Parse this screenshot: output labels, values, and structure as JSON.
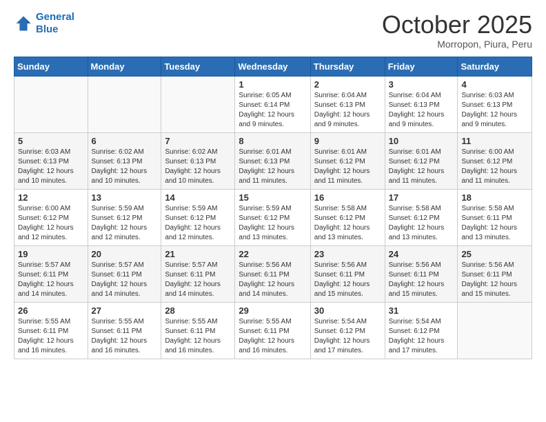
{
  "logo": {
    "line1": "General",
    "line2": "Blue"
  },
  "header": {
    "month": "October 2025",
    "location": "Morropon, Piura, Peru"
  },
  "weekdays": [
    "Sunday",
    "Monday",
    "Tuesday",
    "Wednesday",
    "Thursday",
    "Friday",
    "Saturday"
  ],
  "weeks": [
    [
      {
        "day": "",
        "info": ""
      },
      {
        "day": "",
        "info": ""
      },
      {
        "day": "",
        "info": ""
      },
      {
        "day": "1",
        "info": "Sunrise: 6:05 AM\nSunset: 6:14 PM\nDaylight: 12 hours and 9 minutes."
      },
      {
        "day": "2",
        "info": "Sunrise: 6:04 AM\nSunset: 6:13 PM\nDaylight: 12 hours and 9 minutes."
      },
      {
        "day": "3",
        "info": "Sunrise: 6:04 AM\nSunset: 6:13 PM\nDaylight: 12 hours and 9 minutes."
      },
      {
        "day": "4",
        "info": "Sunrise: 6:03 AM\nSunset: 6:13 PM\nDaylight: 12 hours and 9 minutes."
      }
    ],
    [
      {
        "day": "5",
        "info": "Sunrise: 6:03 AM\nSunset: 6:13 PM\nDaylight: 12 hours and 10 minutes."
      },
      {
        "day": "6",
        "info": "Sunrise: 6:02 AM\nSunset: 6:13 PM\nDaylight: 12 hours and 10 minutes."
      },
      {
        "day": "7",
        "info": "Sunrise: 6:02 AM\nSunset: 6:13 PM\nDaylight: 12 hours and 10 minutes."
      },
      {
        "day": "8",
        "info": "Sunrise: 6:01 AM\nSunset: 6:13 PM\nDaylight: 12 hours and 11 minutes."
      },
      {
        "day": "9",
        "info": "Sunrise: 6:01 AM\nSunset: 6:12 PM\nDaylight: 12 hours and 11 minutes."
      },
      {
        "day": "10",
        "info": "Sunrise: 6:01 AM\nSunset: 6:12 PM\nDaylight: 12 hours and 11 minutes."
      },
      {
        "day": "11",
        "info": "Sunrise: 6:00 AM\nSunset: 6:12 PM\nDaylight: 12 hours and 11 minutes."
      }
    ],
    [
      {
        "day": "12",
        "info": "Sunrise: 6:00 AM\nSunset: 6:12 PM\nDaylight: 12 hours and 12 minutes."
      },
      {
        "day": "13",
        "info": "Sunrise: 5:59 AM\nSunset: 6:12 PM\nDaylight: 12 hours and 12 minutes."
      },
      {
        "day": "14",
        "info": "Sunrise: 5:59 AM\nSunset: 6:12 PM\nDaylight: 12 hours and 12 minutes."
      },
      {
        "day": "15",
        "info": "Sunrise: 5:59 AM\nSunset: 6:12 PM\nDaylight: 12 hours and 13 minutes."
      },
      {
        "day": "16",
        "info": "Sunrise: 5:58 AM\nSunset: 6:12 PM\nDaylight: 12 hours and 13 minutes."
      },
      {
        "day": "17",
        "info": "Sunrise: 5:58 AM\nSunset: 6:12 PM\nDaylight: 12 hours and 13 minutes."
      },
      {
        "day": "18",
        "info": "Sunrise: 5:58 AM\nSunset: 6:11 PM\nDaylight: 12 hours and 13 minutes."
      }
    ],
    [
      {
        "day": "19",
        "info": "Sunrise: 5:57 AM\nSunset: 6:11 PM\nDaylight: 12 hours and 14 minutes."
      },
      {
        "day": "20",
        "info": "Sunrise: 5:57 AM\nSunset: 6:11 PM\nDaylight: 12 hours and 14 minutes."
      },
      {
        "day": "21",
        "info": "Sunrise: 5:57 AM\nSunset: 6:11 PM\nDaylight: 12 hours and 14 minutes."
      },
      {
        "day": "22",
        "info": "Sunrise: 5:56 AM\nSunset: 6:11 PM\nDaylight: 12 hours and 14 minutes."
      },
      {
        "day": "23",
        "info": "Sunrise: 5:56 AM\nSunset: 6:11 PM\nDaylight: 12 hours and 15 minutes."
      },
      {
        "day": "24",
        "info": "Sunrise: 5:56 AM\nSunset: 6:11 PM\nDaylight: 12 hours and 15 minutes."
      },
      {
        "day": "25",
        "info": "Sunrise: 5:56 AM\nSunset: 6:11 PM\nDaylight: 12 hours and 15 minutes."
      }
    ],
    [
      {
        "day": "26",
        "info": "Sunrise: 5:55 AM\nSunset: 6:11 PM\nDaylight: 12 hours and 16 minutes."
      },
      {
        "day": "27",
        "info": "Sunrise: 5:55 AM\nSunset: 6:11 PM\nDaylight: 12 hours and 16 minutes."
      },
      {
        "day": "28",
        "info": "Sunrise: 5:55 AM\nSunset: 6:11 PM\nDaylight: 12 hours and 16 minutes."
      },
      {
        "day": "29",
        "info": "Sunrise: 5:55 AM\nSunset: 6:11 PM\nDaylight: 12 hours and 16 minutes."
      },
      {
        "day": "30",
        "info": "Sunrise: 5:54 AM\nSunset: 6:12 PM\nDaylight: 12 hours and 17 minutes."
      },
      {
        "day": "31",
        "info": "Sunrise: 5:54 AM\nSunset: 6:12 PM\nDaylight: 12 hours and 17 minutes."
      },
      {
        "day": "",
        "info": ""
      }
    ]
  ]
}
